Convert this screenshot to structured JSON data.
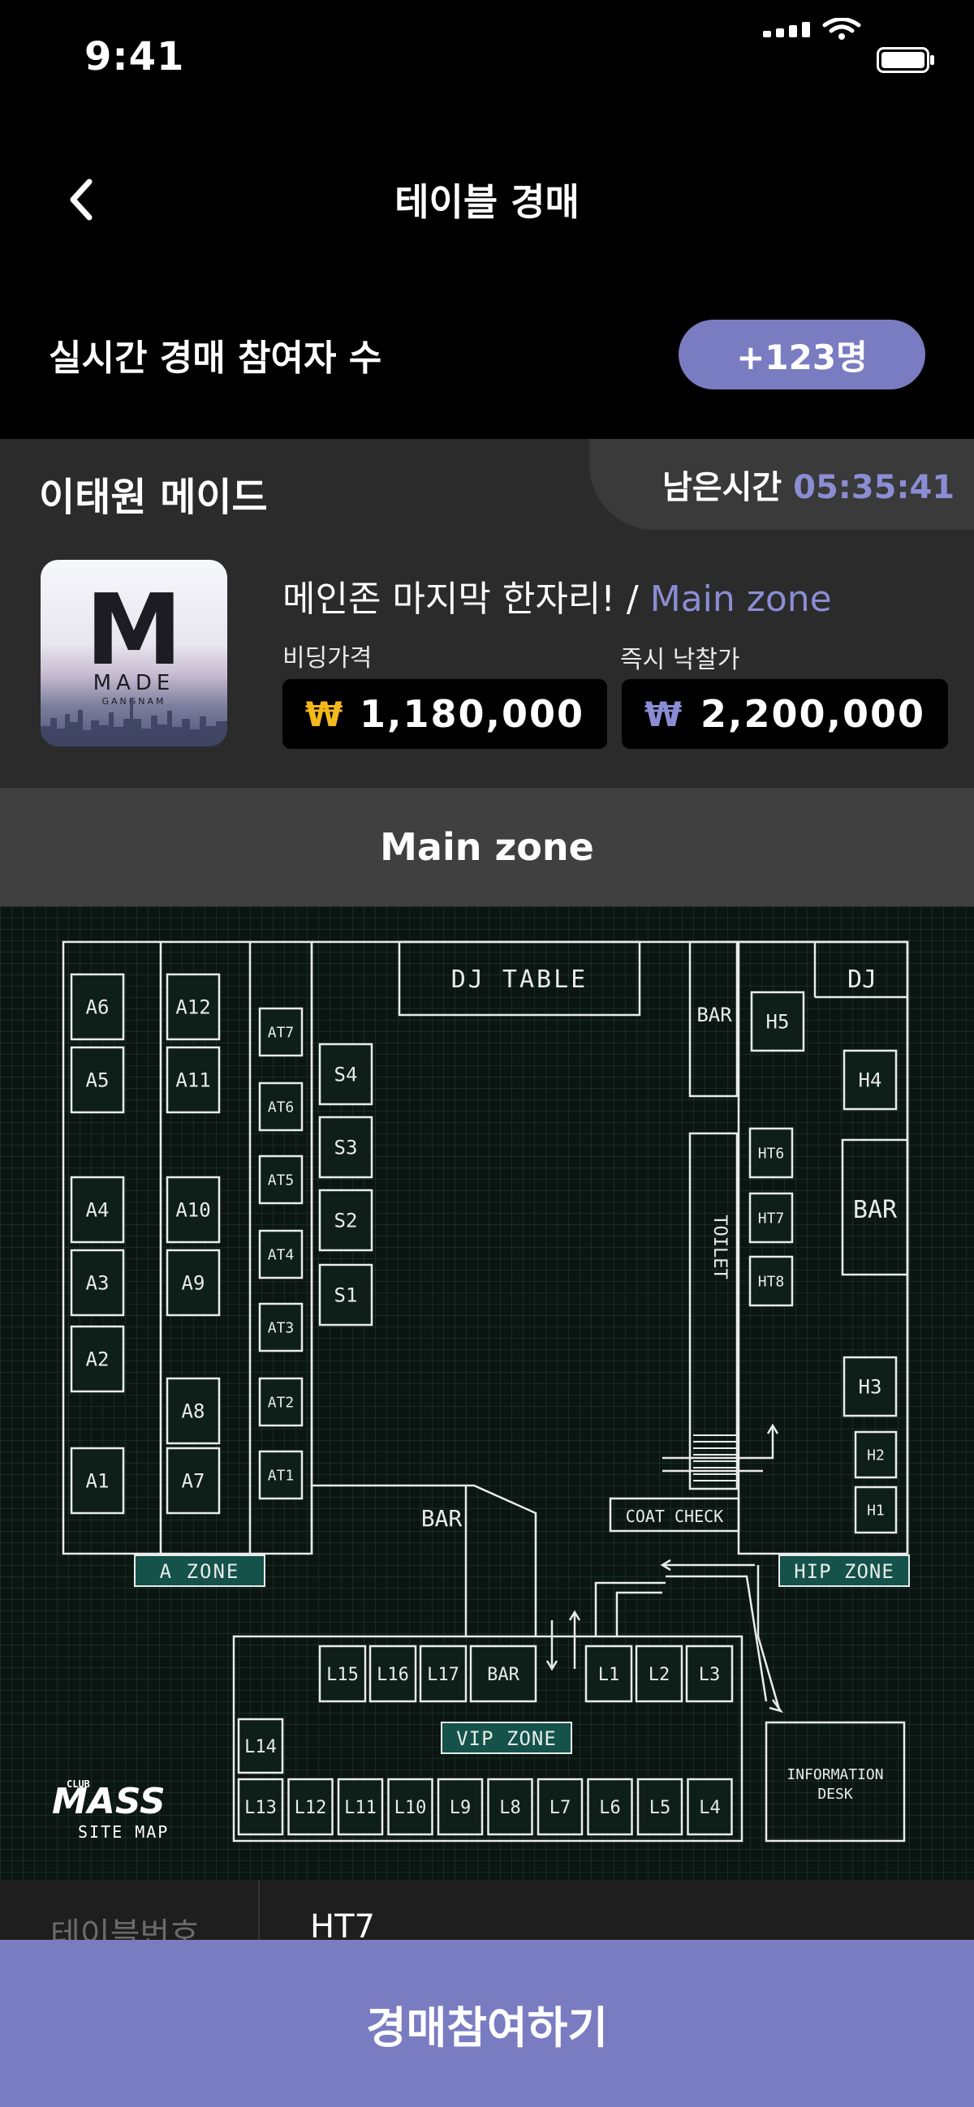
{
  "status_bar": {
    "time": "9:41"
  },
  "header": {
    "title": "테이블 경매"
  },
  "participants": {
    "label": "실시간 경매 참여자 수",
    "count": "+123명"
  },
  "auction": {
    "venue_name": "이태원 메이드",
    "remaining_label": "남은시간",
    "remaining_time": "05:35:41",
    "logo_text": "M",
    "logo_brand": "MADE",
    "logo_sub": "GANGNAM",
    "product_title": "메인존 마지막 한자리! / ",
    "product_zone": "Main zone",
    "bidding_label": "비딩가격",
    "bidding_currency": "₩",
    "bidding_price": "1,180,000",
    "instant_label": "즉시 낙찰가",
    "instant_currency": "₩",
    "instant_price": "2,200,000",
    "currency_colors": {
      "bidding": "#f3b81b",
      "instant": "#8b8dd4"
    }
  },
  "zone_header": {
    "title": "Main zone"
  },
  "map": {
    "labels": {
      "dj_table": "DJ TABLE",
      "bar_top": "BAR",
      "dj": "DJ",
      "bar_right": "BAR",
      "toilet": "TOILET",
      "bar_center": "BAR",
      "coat_check": "COAT CHECK",
      "a_zone": "A ZONE",
      "hip_zone": "HIP ZONE",
      "vip_zone": "VIP ZONE",
      "info_desk_1": "INFORMATION",
      "info_desk_2": "DESK",
      "vip_bar": "BAR",
      "brand_small": "CLUB",
      "brand": "MASS",
      "brand_sub": "SITE MAP"
    },
    "a_col1": [
      "A6",
      "A5",
      "A4",
      "A3",
      "A2",
      "A1"
    ],
    "a_col2": [
      "A12",
      "A11",
      "A10",
      "A9",
      "A8",
      "A7"
    ],
    "at_col": [
      "AT7",
      "AT6",
      "AT5",
      "AT4",
      "AT3",
      "AT2",
      "AT1"
    ],
    "s_col": [
      "S4",
      "S3",
      "S2",
      "S1"
    ],
    "h_right": [
      "H5",
      "H4",
      "H3",
      "H2",
      "H1"
    ],
    "ht_col": [
      "HT6",
      "HT7",
      "HT8"
    ],
    "vip_top": [
      "L15",
      "L16",
      "L17",
      "L1",
      "L2",
      "L3"
    ],
    "vip_side": [
      "L14"
    ],
    "vip_bottom": [
      "L13",
      "L12",
      "L11",
      "L10",
      "L9",
      "L8",
      "L7",
      "L6",
      "L5",
      "L4"
    ]
  },
  "bottom": {
    "table_no_label": "테이블번호",
    "table_no_value": "HT7"
  },
  "cta": {
    "label": "경매참여하기"
  },
  "colors": {
    "accent": "#7a7cc2"
  }
}
